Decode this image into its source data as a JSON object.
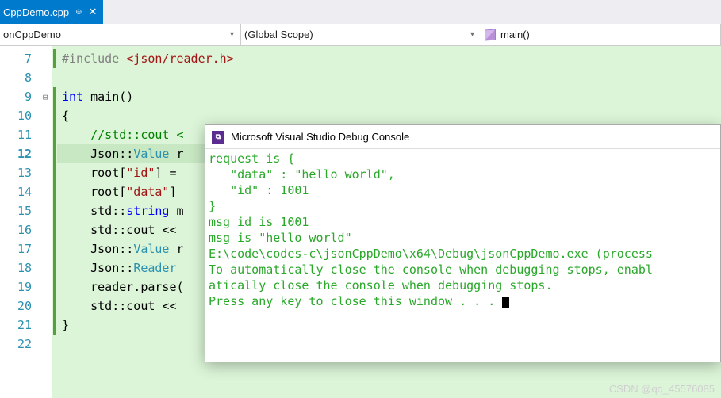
{
  "tab": {
    "filename": "CppDemo.cpp"
  },
  "nav": {
    "project": "onCppDemo",
    "scope": "(Global Scope)",
    "func": "main()"
  },
  "gutter": [
    "7",
    "8",
    "9",
    "10",
    "11",
    "12",
    "13",
    "14",
    "15",
    "16",
    "17",
    "18",
    "19",
    "20",
    "21",
    "22"
  ],
  "code": {
    "l7_pp": "#include ",
    "l7_inc": "<json/reader.h>",
    "l8": "",
    "l9_kw": "int",
    "l9_fn": " main()",
    "l10": "{",
    "l11": "    //std::cout <",
    "l12a": "    Json::",
    "l12b": "Value",
    "l12c": " r",
    "l13a": "    root[",
    "l13b": "\"id\"",
    "l13c": "] =",
    "l14a": "    root[",
    "l14b": "\"data\"",
    "l14c": "]",
    "l15a": "    std::",
    "l15b": "string",
    "l15c": " m",
    "l16": "    std::cout <<",
    "l17a": "    Json::",
    "l17b": "Value",
    "l17c": " r",
    "l18a": "    Json::",
    "l18b": "Reader",
    "l19": "    reader.parse(",
    "l20": "    std::cout <<",
    "l21": "}"
  },
  "console": {
    "title": "Microsoft Visual Studio Debug Console",
    "out1": "request is {",
    "out2": "   \"data\" : \"hello world\",",
    "out3": "   \"id\" : 1001",
    "out4": "}",
    "out5": "",
    "out6": "msg id is 1001",
    "out7": "msg is \"hello world\"",
    "out8": "",
    "out9": "",
    "out10": "E:\\code\\codes-c\\jsonCppDemo\\x64\\Debug\\jsonCppDemo.exe (process",
    "out11": "To automatically close the console when debugging stops, enabl",
    "out12": "atically close the console when debugging stops.",
    "out13": "Press any key to close this window . . . "
  },
  "watermark": "CSDN @qq_45576085"
}
